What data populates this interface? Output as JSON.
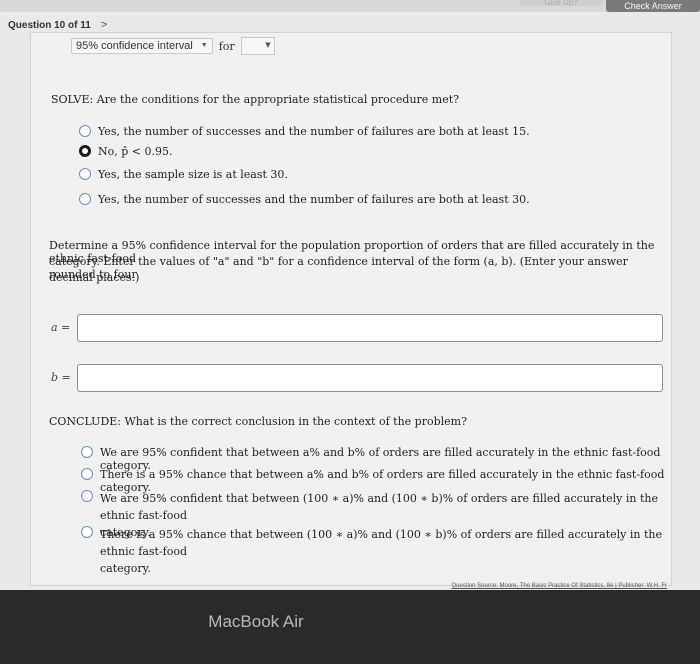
{
  "header": {
    "give_up": "Give Up?",
    "check_answer": "Check Answer",
    "question_nav": "Question 10 of 11",
    "next_chevron": ">"
  },
  "ci_row": {
    "select_value": "95% confidence interval",
    "for_text": "for",
    "blank_select": ""
  },
  "solve": {
    "prompt": "SOLVE: Are the conditions for the appropriate statistical procedure met?",
    "options": [
      "Yes, the number of successes and the number of failures are both at least 15.",
      "No, p̂ < 0.95.",
      "Yes, the sample size is at least 30.",
      "Yes, the number of successes and the number of failures are both at least 30."
    ],
    "selected_index": 1
  },
  "determine": {
    "line1": "Determine a 95% confidence interval for the population proportion of orders that are filled accurately in the ethnic fast-food",
    "line2": "category. Enter the values of \"a\" and \"b\" for a confidence interval of the form (a, b). (Enter your answer rounded to four",
    "line3": "decimal places.)"
  },
  "inputs": {
    "a_label": "a =",
    "a_value": "",
    "b_label": "b =",
    "b_value": ""
  },
  "conclude": {
    "prompt": "CONCLUDE: What is the correct conclusion in the context of the problem?",
    "options": [
      [
        "We are 95% confident that between a% and b% of orders are filled accurately in the ethnic fast-food category."
      ],
      [
        "There is a 95% chance that between a% and b% of orders are filled accurately in the ethnic fast-food category."
      ],
      [
        "We are 95% confident that between (100 ∗ a)% and (100 ∗ b)% of orders are filled accurately in the ethnic fast-food",
        "category."
      ],
      [
        "There is a 95% chance that between (100 ∗ a)% and (100 ∗ b)% of orders are filled accurately in the ethnic fast-food",
        "category."
      ]
    ]
  },
  "footer": {
    "source": "Question Source: Moore, The Basic Practice Of Statistics, 8e  |  Publisher: W.H. Fr",
    "device_label": "MacBook Air"
  },
  "colors": {
    "panel_bg": "#f1f1f2",
    "check_button_bg": "#7a7a7c",
    "radio_accent": "#6e8ec4"
  }
}
